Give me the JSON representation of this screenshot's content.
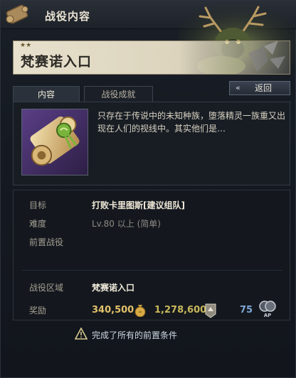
{
  "window": {
    "title": "战役内容",
    "icon": "scroll-icon"
  },
  "quest": {
    "stars": "★★",
    "name": "梵赛诺入口"
  },
  "tabs": [
    {
      "label": "内容",
      "active": true
    },
    {
      "label": "战役成就",
      "active": false
    }
  ],
  "back_button": {
    "chevron": "«",
    "label": "返回"
  },
  "description": "只存在于传说中的未知种族，堕落精灵一族重又出现在人们的视线中。其实他们是…",
  "details": {
    "objective": {
      "label": "目标",
      "value": "打败卡里图斯[建议组队]"
    },
    "difficulty": {
      "label": "难度",
      "value": "Lv.80 以上 (简单)"
    },
    "prerequisite": {
      "label": "前置战役",
      "value": ""
    },
    "region": {
      "label": "战役区域",
      "value": "梵赛诺入口"
    },
    "reward": {
      "label": "奖励",
      "gold": "340,500",
      "exp": "1,278,600",
      "ap": "75"
    }
  },
  "prereq_notice": {
    "icon": "warning-icon",
    "text": "完成了所有的前置条件"
  },
  "colors": {
    "accent_gold": "#e2c26a",
    "ap_blue": "#7fa8d6",
    "banner": "#dcd4bd"
  }
}
